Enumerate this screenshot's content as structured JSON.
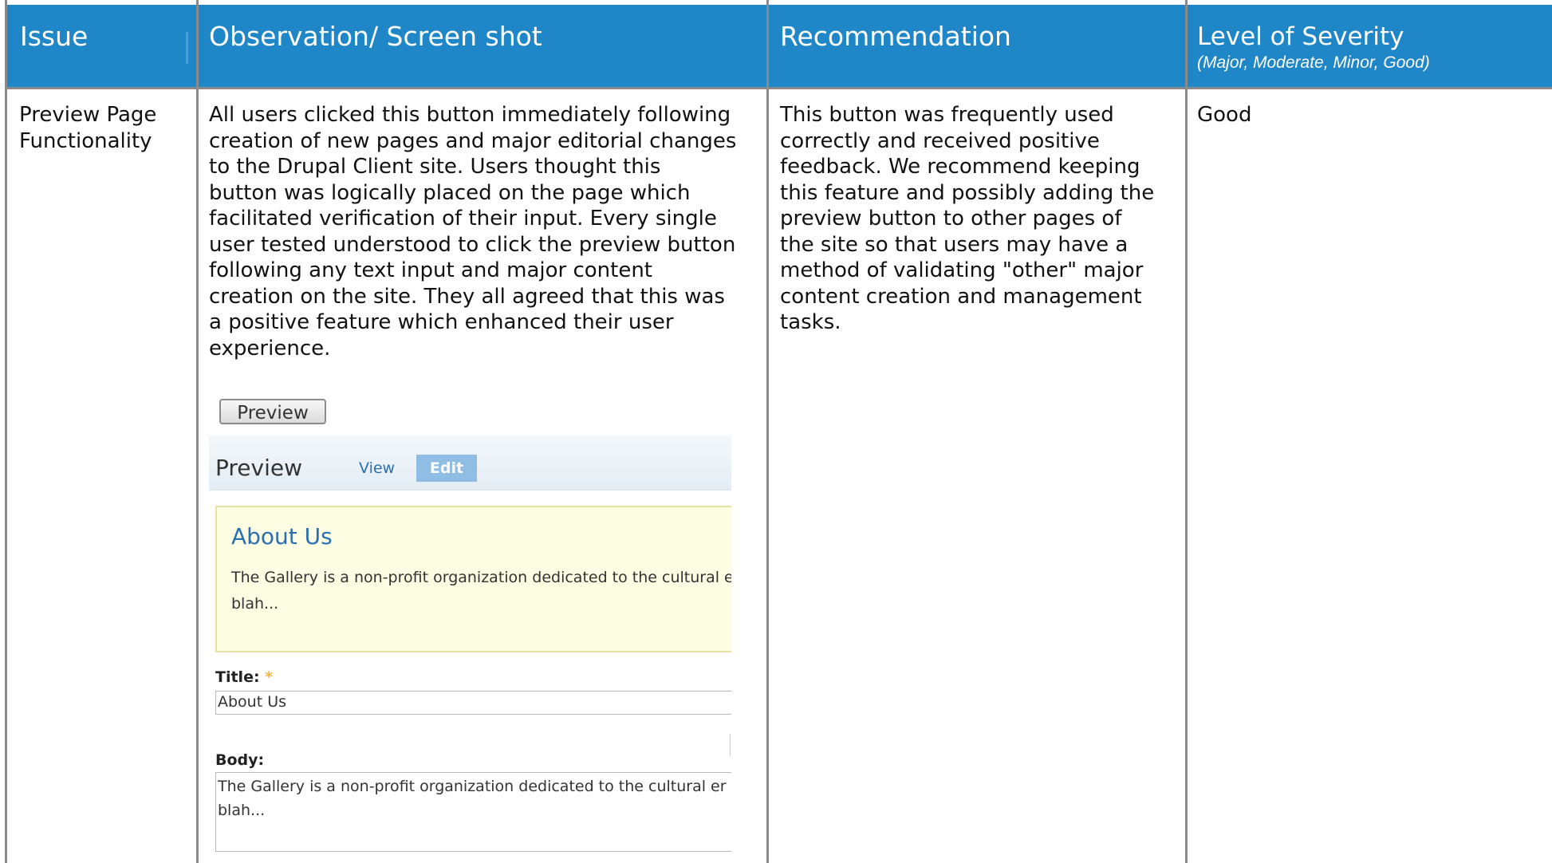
{
  "header": {
    "col1": "Issue",
    "col2": "Observation/ Screen shot",
    "col3": "Recommendation",
    "col4": "Level of Severity",
    "col4_sub": "(Major, Moderate, Minor, Good)"
  },
  "row": {
    "issue_line1": "Preview Page",
    "issue_line2": "Functionality",
    "observation": [
      "All users clicked this button immediately following",
      "creation of new pages and major editorial changes",
      "to the Drupal Client site.  Users thought this",
      "button was logically placed on the page which",
      "facilitated verification of their input. Every single",
      "user tested understood to click the preview button",
      "following any text input and major content",
      "creation on the site.  They all agreed that this was",
      "a positive feature which enhanced their user",
      "experience."
    ],
    "recommendation": [
      "This button was frequently used",
      "correctly and received positive",
      "feedback.  We recommend keeping",
      "this feature and possibly adding the",
      "preview button to other pages of",
      "the site so that users may have a",
      "method of validating \"other\" major",
      "content creation and management",
      "tasks."
    ],
    "severity": "Good"
  },
  "screenshot": {
    "preview_button": "Preview",
    "tab_title": "Preview",
    "tab_view": "View",
    "tab_edit": "Edit",
    "preview_heading": "About Us",
    "preview_body_line1": "The Gallery is a non-profit organization dedicated to the cultural e",
    "preview_body_line2": "blah...",
    "title_label": "Title:",
    "required_mark": "*",
    "title_value": "About Us",
    "body_label": "Body:",
    "body_line1": "The Gallery is a non-profit organization dedicated to  the cultural er",
    "body_line2": "blah..."
  },
  "colors": {
    "header_bg": "#1f87c8",
    "grid_line": "#8a8a8a",
    "link_blue": "#2a6fb0",
    "edit_tab": "#8fbde3",
    "preview_bg": "#fdfde3"
  }
}
